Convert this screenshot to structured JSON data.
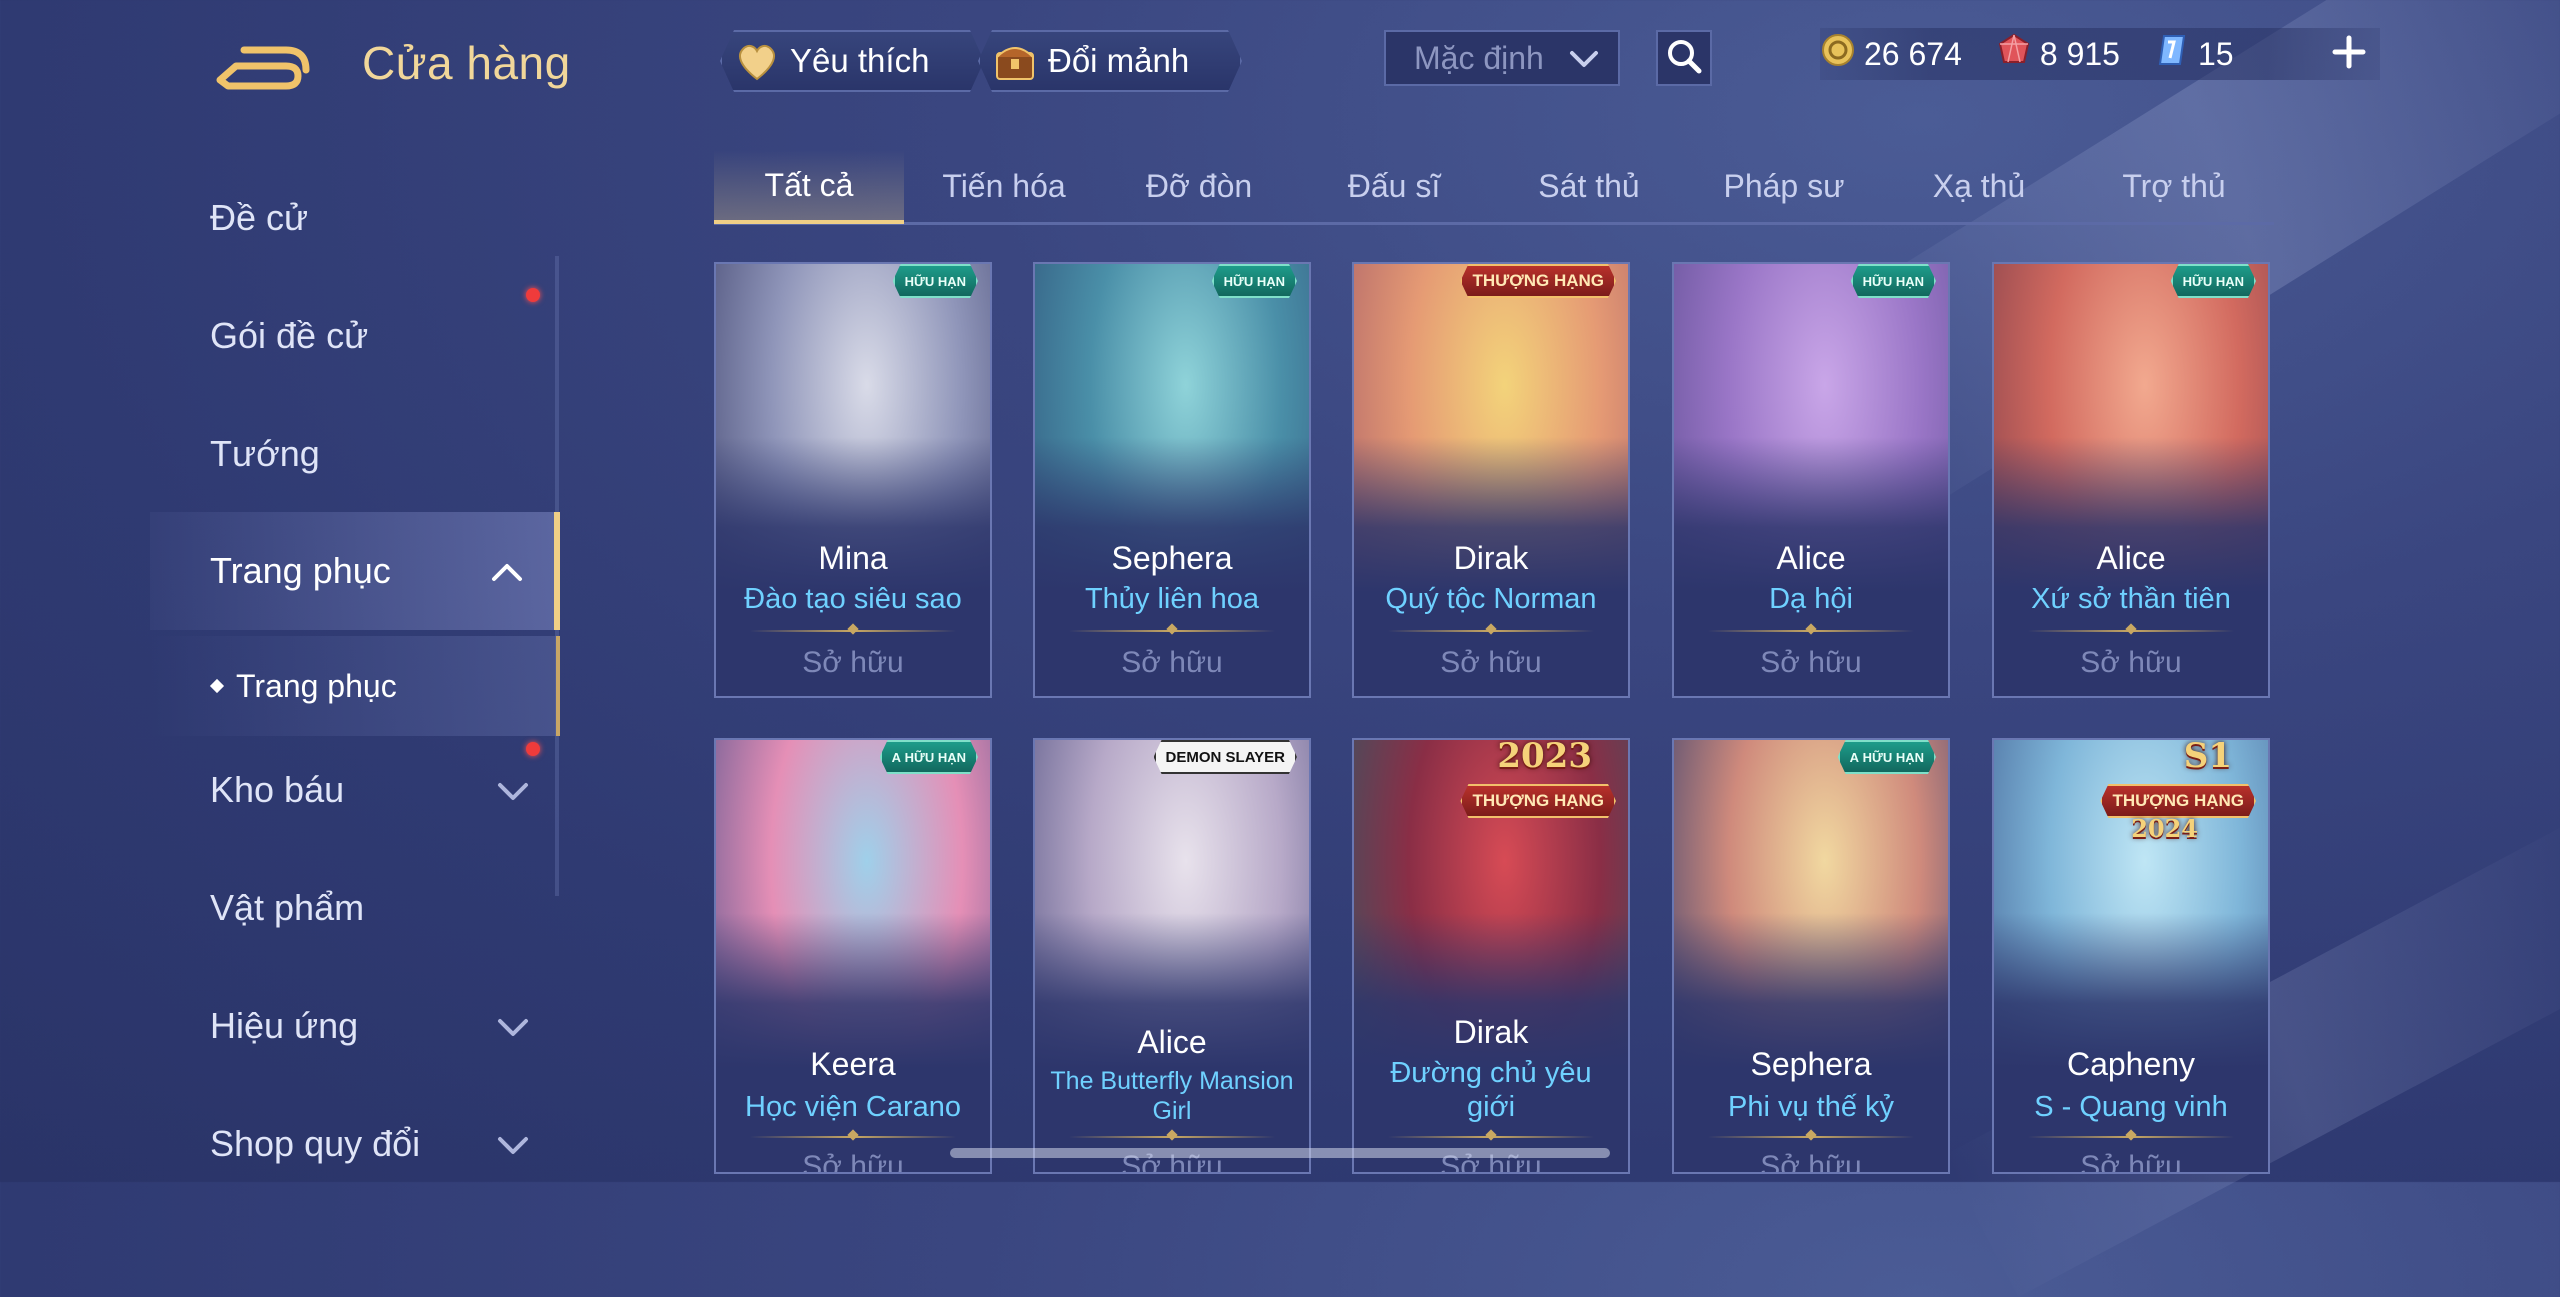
{
  "header": {
    "title": "Cửa hàng",
    "favorite_label": "Yêu thích",
    "shard_label": "Đổi mảnh",
    "sort_value": "Mặc định",
    "currencies": [
      {
        "name": "gold",
        "value": "26 674",
        "color": "#e8c25a"
      },
      {
        "name": "vouchers",
        "value": "8 915",
        "color": "#e0545a"
      },
      {
        "name": "quan-huy",
        "value": "15",
        "color": "#7fb7ff"
      }
    ]
  },
  "sidebar": {
    "items": [
      {
        "label": "Đề cử"
      },
      {
        "label": "Gói đề cử"
      },
      {
        "label": "Tướng"
      },
      {
        "label": "Trang phục"
      },
      {
        "label": "Trang phục"
      },
      {
        "label": "Kho báu"
      },
      {
        "label": "Vật phẩm"
      },
      {
        "label": "Hiệu ứng"
      },
      {
        "label": "Shop quy đổi"
      }
    ]
  },
  "tabs": [
    {
      "label": "Tất cả"
    },
    {
      "label": "Tiến hóa"
    },
    {
      "label": "Đỡ đòn"
    },
    {
      "label": "Đấu sĩ"
    },
    {
      "label": "Sát thủ"
    },
    {
      "label": "Pháp sư"
    },
    {
      "label": "Xạ thủ"
    },
    {
      "label": "Trợ thủ"
    }
  ],
  "cards": [
    {
      "hero": "Mina",
      "skin": "Đào tạo siêu sao",
      "status": "Sở hữu",
      "badge": "HỮU HẠN",
      "colors": [
        "#d9dbe8",
        "#8f95b9",
        "#3b3f6a"
      ]
    },
    {
      "hero": "Sephera",
      "skin": "Thủy liên hoa",
      "status": "Sở hữu",
      "badge": "HỮU HẠN",
      "colors": [
        "#8fd3d9",
        "#4a8fa8",
        "#2d4f77"
      ]
    },
    {
      "hero": "Dirak",
      "skin": "Quý tộc Norman",
      "status": "Sở hữu",
      "badge": "THƯỢNG HẠNG",
      "colors": [
        "#f3d37a",
        "#e59a74",
        "#a45a67"
      ]
    },
    {
      "hero": "Alice",
      "skin": "Dạ hội",
      "status": "Sở hữu",
      "badge": "HỮU HẠN",
      "colors": [
        "#c9a6e8",
        "#9a76c7",
        "#5a4b8f"
      ]
    },
    {
      "hero": "Alice",
      "skin": "Xứ sở thần tiên",
      "status": "Sở hữu",
      "badge": "HỮU HẠN",
      "colors": [
        "#f2a98f",
        "#d26a5f",
        "#7a3b49"
      ]
    },
    {
      "hero": "Keera",
      "skin": "Học viện Carano",
      "status": "Sở hữu",
      "badge": "HỮU HẠN",
      "badge_top": "A",
      "colors": [
        "#9fd0ea",
        "#e58fb6",
        "#4b4f8a"
      ]
    },
    {
      "hero": "Alice",
      "skin": "The Butterfly Mansion Girl",
      "status": "Sở hữu",
      "badge": "DEMON SLAYER",
      "colors": [
        "#e8e2ec",
        "#b7a9c8",
        "#4e4f80"
      ]
    },
    {
      "hero": "Dirak",
      "skin": "Đường chủ yêu giới",
      "status": "Sở hữu",
      "badge": "THƯỢNG HẠNG",
      "year": "2023",
      "colors": [
        "#d74b55",
        "#8a2e46",
        "#2b5b68"
      ]
    },
    {
      "hero": "Sephera",
      "skin": "Phi vụ thế kỷ",
      "status": "Sở hữu",
      "badge": "HỮU HẠN",
      "badge_top": "A",
      "colors": [
        "#f1d8a0",
        "#cf8a7c",
        "#2b3a6e"
      ]
    },
    {
      "hero": "Capheny",
      "skin": "S - Quang vinh",
      "status": "Sở hữu",
      "badge": "THƯỢNG HẠNG",
      "year": "S1",
      "year2": "2024",
      "colors": [
        "#bfe6f5",
        "#7fb6d9",
        "#3f5c90"
      ]
    }
  ]
}
